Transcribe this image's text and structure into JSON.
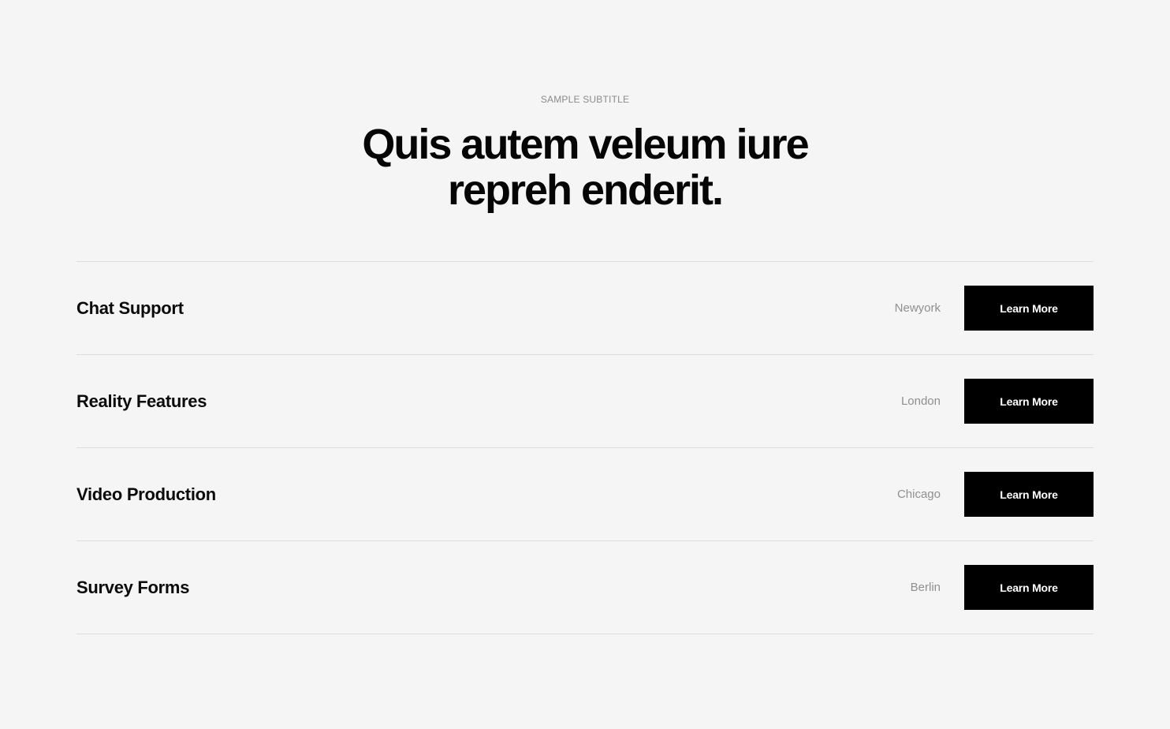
{
  "header": {
    "subtitle": "SAMPLE SUBTITLE",
    "title_line1": "Quis autem veleum iure",
    "title_line2": "repreh enderit."
  },
  "items": [
    {
      "title": "Chat Support",
      "location": "Newyork",
      "button_label": "Learn More"
    },
    {
      "title": "Reality Features",
      "location": "London",
      "button_label": "Learn More"
    },
    {
      "title": "Video Production",
      "location": "Chicago",
      "button_label": "Learn More"
    },
    {
      "title": "Survey Forms",
      "location": "Berlin",
      "button_label": "Learn More"
    }
  ],
  "colors": {
    "background": "#f5f5f5",
    "text": "#0b0b0b",
    "muted": "#8f8f8f",
    "button_bg": "#000000",
    "button_text": "#ffffff",
    "divider": "#dcdcdc"
  }
}
